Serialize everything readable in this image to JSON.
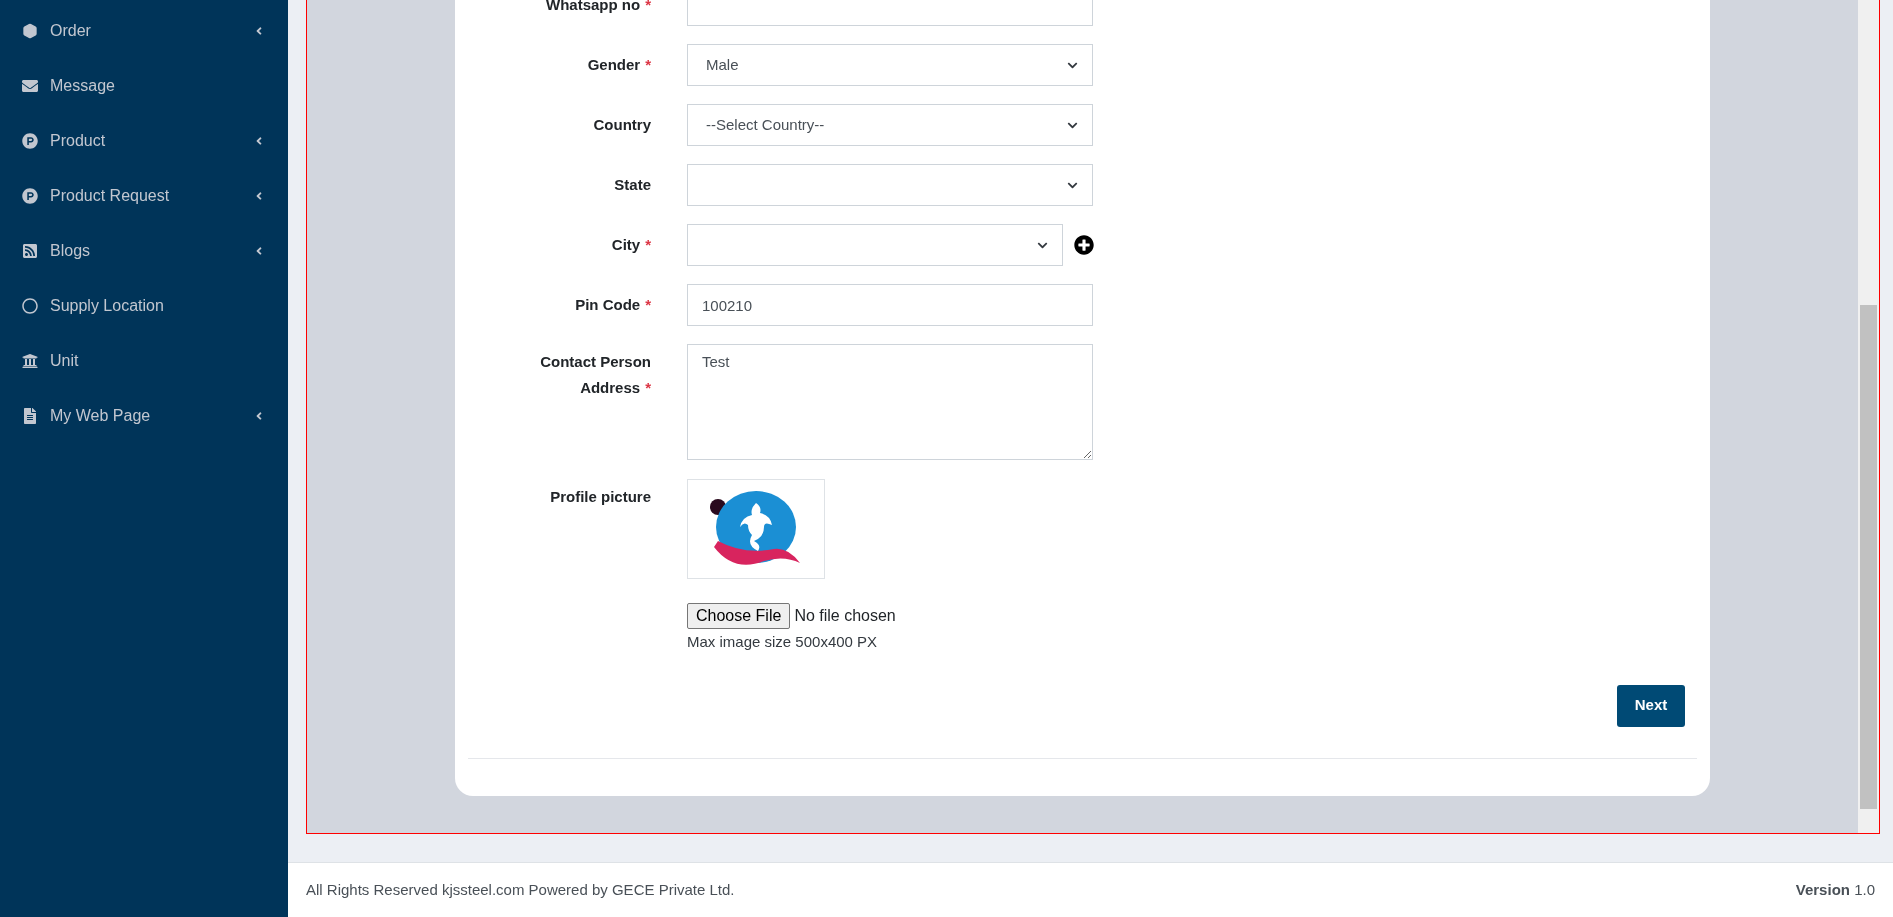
{
  "sidebar": {
    "items": [
      {
        "label": "Order",
        "kind": "hexagon",
        "expandable": true
      },
      {
        "label": "Message",
        "kind": "envelope",
        "expandable": false
      },
      {
        "label": "Product",
        "kind": "p-circle",
        "expandable": true
      },
      {
        "label": "Product Request",
        "kind": "p-circle",
        "expandable": true
      },
      {
        "label": "Blogs",
        "kind": "rss",
        "expandable": true
      },
      {
        "label": "Supply Location",
        "kind": "circle",
        "expandable": false
      },
      {
        "label": "Unit",
        "kind": "bank",
        "expandable": false
      },
      {
        "label": "My Web Page",
        "kind": "file",
        "expandable": true
      }
    ]
  },
  "form": {
    "fields": [
      {
        "kind": "input",
        "label": "Whatsapp no",
        "mark": "*"
      },
      {
        "kind": "select",
        "label": "Gender",
        "mark": "*",
        "value": "Male"
      },
      {
        "kind": "select",
        "label": "Country",
        "value": "--Select Country--"
      },
      {
        "kind": "select",
        "label": "State"
      },
      {
        "kind": "select-add",
        "label": "City",
        "mark": "*"
      },
      {
        "kind": "input",
        "label": "Pin Code",
        "mark": "*",
        "value": "100210"
      },
      {
        "kind": "textarea",
        "label": "Contact Person Address",
        "mark": "*",
        "value": "Test"
      },
      {
        "kind": "file",
        "label": "Profile picture",
        "button": "Choose File",
        "file_status": "No file chosen",
        "hint": "Max image size 500x400 PX"
      }
    ],
    "submit": "Next"
  },
  "footer": {
    "text": "All Rights Reserved kjssteel.com Powered by GECE Private Ltd.",
    "version": "**Version** 1.0"
  }
}
